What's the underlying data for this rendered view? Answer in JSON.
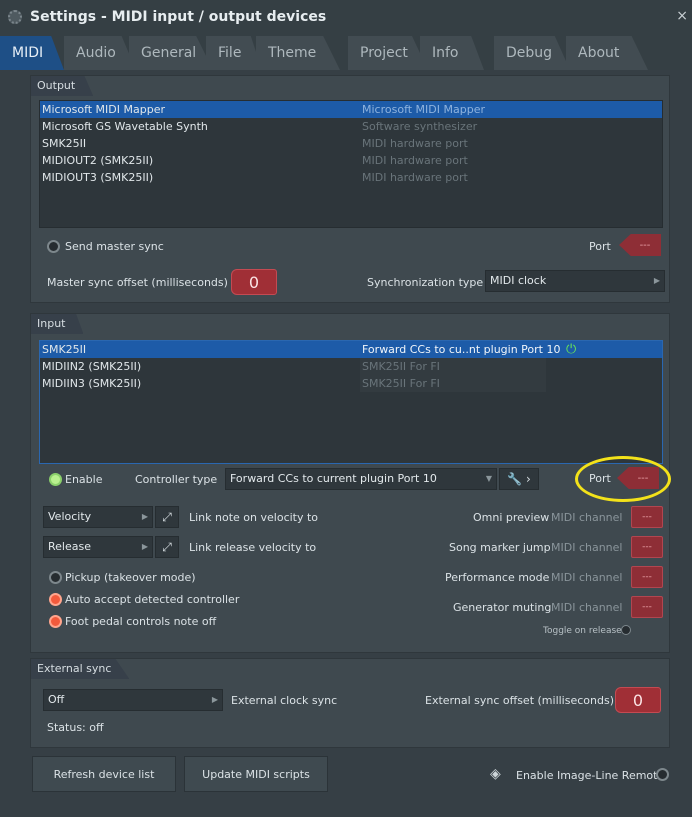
{
  "window": {
    "title": "Settings - MIDI input / output devices",
    "close": "×"
  },
  "tabs": [
    {
      "label": "MIDI",
      "active": true
    },
    {
      "label": "Audio"
    },
    {
      "label": "General"
    },
    {
      "label": "File"
    },
    {
      "label": "Theme"
    },
    {
      "label": "Project"
    },
    {
      "label": "Info"
    },
    {
      "label": "Debug"
    },
    {
      "label": "About"
    }
  ],
  "output": {
    "title": "Output",
    "devices": [
      {
        "name": "Microsoft MIDI Mapper",
        "type": "Microsoft MIDI Mapper"
      },
      {
        "name": "Microsoft GS Wavetable Synth",
        "type": "Software synthesizer"
      },
      {
        "name": "SMK25II",
        "type": "MIDI hardware port"
      },
      {
        "name": "MIDIOUT2 (SMK25II)",
        "type": "MIDI hardware port"
      },
      {
        "name": "MIDIOUT3 (SMK25II)",
        "type": "MIDI hardware port"
      }
    ],
    "send_master_sync": "Send master sync",
    "port_label": "Port",
    "port_value": "---",
    "sync_offset_label": "Master sync offset (milliseconds)",
    "sync_offset_value": "0",
    "sync_type_label": "Synchronization type",
    "sync_type_value": "MIDI clock"
  },
  "input": {
    "title": "Input",
    "devices": [
      {
        "name": "SMK25II",
        "mapping": "Forward CCs to cu..nt plugin Port 10"
      },
      {
        "name": "MIDIIN2 (SMK25II)",
        "mapping": "SMK25II For FI"
      },
      {
        "name": "MIDIIN3 (SMK25II)",
        "mapping": "SMK25II For FI"
      }
    ],
    "enable": "Enable",
    "controller_type_label": "Controller type",
    "controller_type_value": "Forward CCs to current plugin Port 10",
    "port_label": "Port",
    "port_value": "---",
    "velocity": "Velocity",
    "link_velocity": "Link note on velocity to",
    "release": "Release",
    "link_release": "Link release velocity to",
    "pickup": "Pickup (takeover mode)",
    "auto_accept": "Auto accept detected controller",
    "foot_pedal": "Foot pedal controls note off",
    "omni_label": "Omni preview",
    "song_marker_label": "Song marker jump",
    "performance_label": "Performance mode",
    "generator_label": "Generator muting",
    "midi_channel": "MIDI channel",
    "channel_value": "---",
    "toggle_release": "Toggle on release"
  },
  "external_sync": {
    "title": "External sync",
    "mode_value": "Off",
    "clock_label": "External clock sync",
    "offset_label": "External sync offset (milliseconds)",
    "offset_value": "0",
    "status": "Status: off"
  },
  "footer": {
    "refresh": "Refresh device list",
    "update_scripts": "Update MIDI scripts",
    "remote": "Enable Image-Line Remote"
  }
}
